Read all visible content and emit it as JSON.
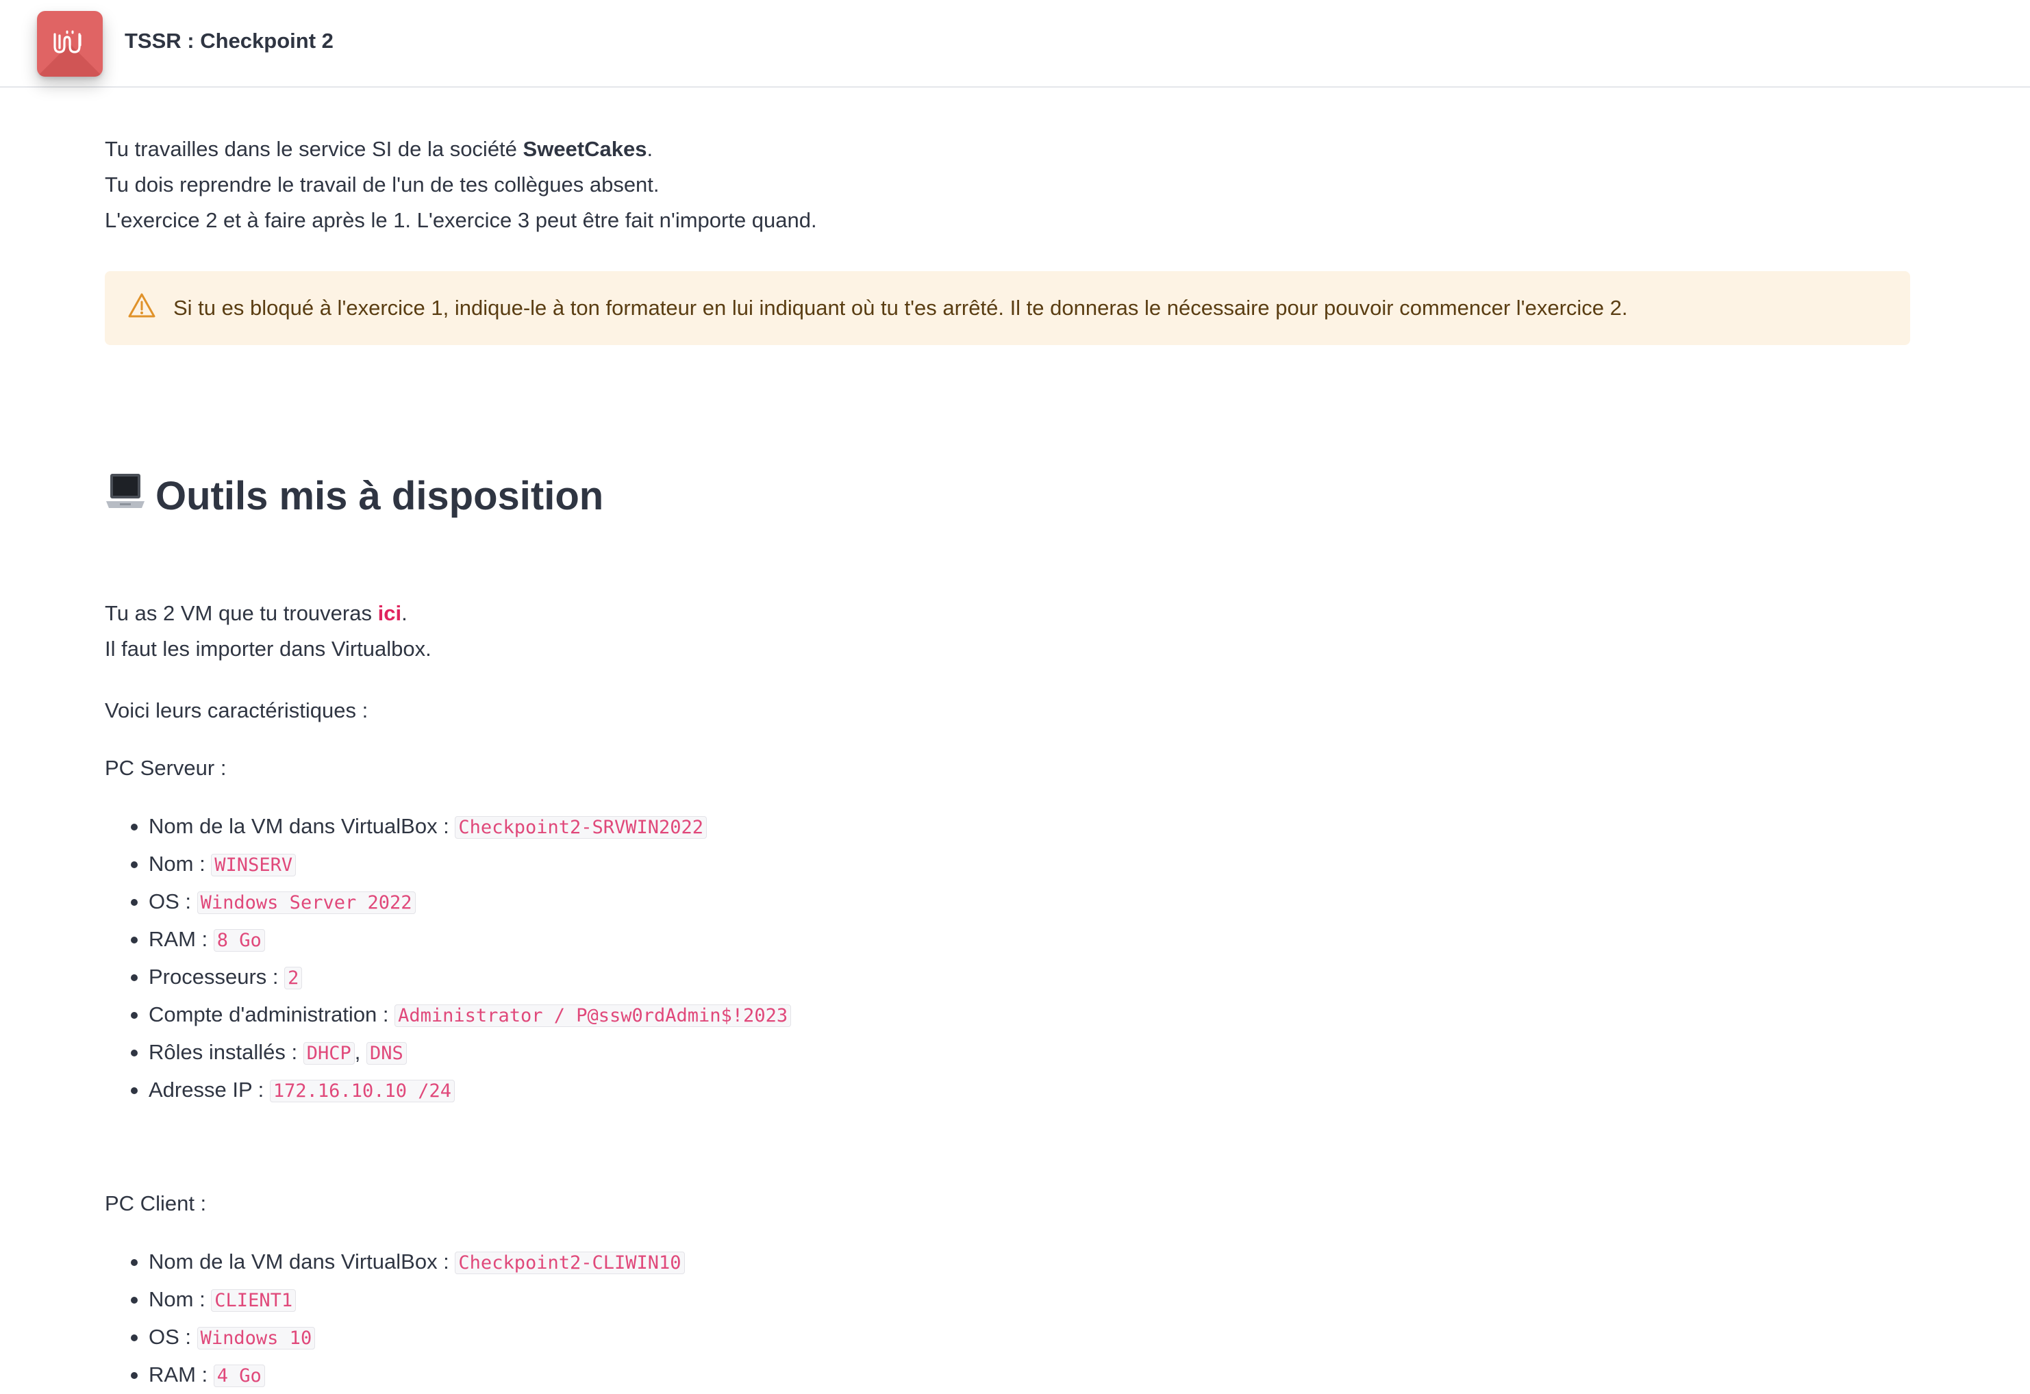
{
  "header": {
    "title": "TSSR : Checkpoint 2",
    "logo_icon": "wave-logo-icon",
    "logo_color": "#e06464"
  },
  "intro": {
    "line1_prefix": "Tu travailles dans le service SI de la société ",
    "line1_company": "SweetCakes",
    "line1_suffix": ".",
    "line2": "Tu dois reprendre le travail de l'un de tes collègues absent.",
    "line3": "L'exercice 2 et à faire après le 1. L'exercice 3 peut être fait n'importe quand."
  },
  "warning": {
    "icon": "warning-triangle-icon",
    "text": "Si tu es bloqué à l'exercice 1, indique-le à ton formateur en lui indiquant où tu t'es arrêté. Il te donneras le nécessaire pour pouvoir commencer l'exercice 2.",
    "bg_color": "#fdf3e4"
  },
  "tools": {
    "icon": "laptop-icon",
    "heading": "Outils mis à disposition",
    "vm_line_prefix": "Tu as 2 VM que tu trouveras ",
    "vm_link": "ici",
    "vm_line_suffix": ".",
    "import_line": "Il faut les importer dans Virtualbox.",
    "characteristics": "Voici leurs caractéristiques :"
  },
  "server": {
    "title": "PC Serveur :",
    "items": [
      {
        "label": "Nom de la VM dans VirtualBox : ",
        "code": "Checkpoint2-SRVWIN2022"
      },
      {
        "label": "Nom : ",
        "code": "WINSERV"
      },
      {
        "label": "OS : ",
        "code": "Windows Server 2022"
      },
      {
        "label": "RAM : ",
        "code": "8 Go"
      },
      {
        "label": "Processeurs : ",
        "code": "2"
      },
      {
        "label": "Compte d'administration : ",
        "code": "Administrator / P@ssw0rdAdmin$!2023"
      },
      {
        "label": "Rôles installés : ",
        "code": "DHCP",
        "separator": ", ",
        "code2": "DNS"
      },
      {
        "label": "Adresse IP : ",
        "code": "172.16.10.10 /24"
      }
    ]
  },
  "client": {
    "title": "PC Client :",
    "items": [
      {
        "label": "Nom de la VM dans VirtualBox : ",
        "code": "Checkpoint2-CLIWIN10"
      },
      {
        "label": "Nom : ",
        "code": "CLIENT1"
      },
      {
        "label": "OS : ",
        "code": "Windows 10"
      },
      {
        "label": "RAM : ",
        "code": "4 Go"
      }
    ]
  },
  "colors": {
    "link": "#e0245e",
    "code_text": "#e0487a"
  }
}
